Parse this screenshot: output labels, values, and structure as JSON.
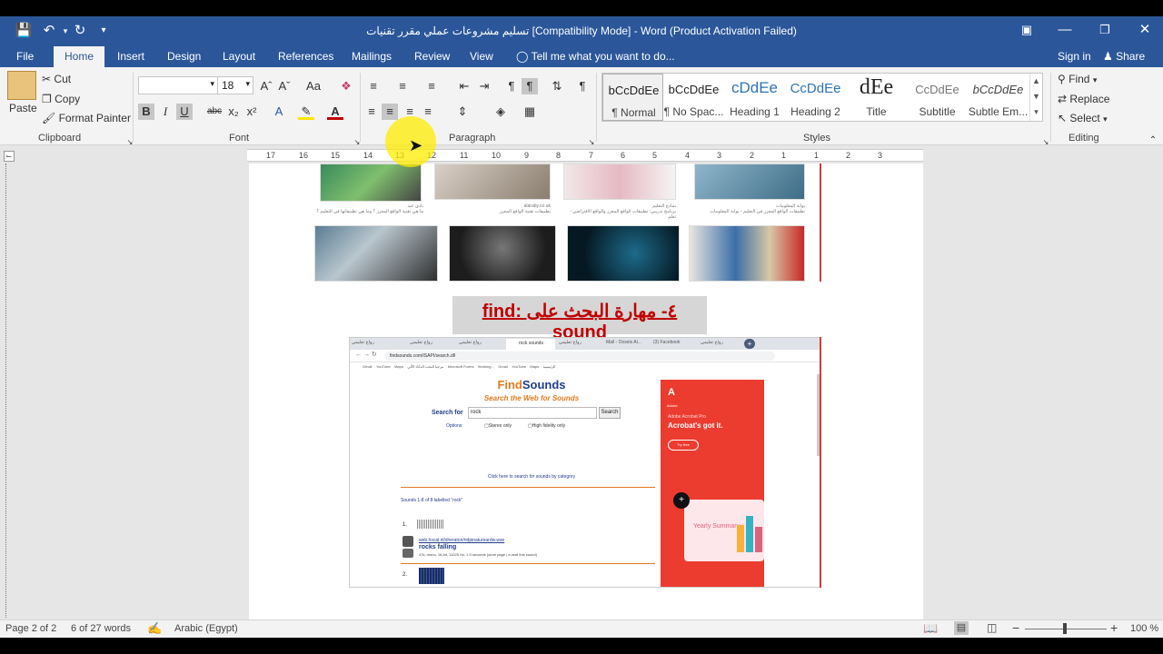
{
  "window": {
    "title": "تسليم مشروعات عملي مقرر تقنيات [Compatibility Mode] - Word (Product Activation Failed)"
  },
  "tabs": [
    "File",
    "Home",
    "Insert",
    "Design",
    "Layout",
    "References",
    "Mailings",
    "Review",
    "View"
  ],
  "tell_me": "Tell me what you want to do...",
  "account": {
    "sign_in": "Sign in",
    "share": "Share"
  },
  "clipboard": {
    "paste": "Paste",
    "cut": "Cut",
    "copy": "Copy",
    "format_painter": "Format Painter",
    "group": "Clipboard"
  },
  "font": {
    "name": "",
    "size": "18",
    "group": "Font",
    "change_case": "Aa"
  },
  "paragraph": {
    "group": "Paragraph"
  },
  "styles": {
    "group": "Styles",
    "items": [
      {
        "preview": "bCcDdEe",
        "label": "¶ Normal"
      },
      {
        "preview": "bCcDdEe",
        "label": "¶ No Spac..."
      },
      {
        "preview": "cDdEe",
        "label": "Heading 1"
      },
      {
        "preview": "CcDdEe",
        "label": "Heading 2"
      },
      {
        "preview": "dEe",
        "label": "Title"
      },
      {
        "preview": "CcDdEe",
        "label": "Subtitle"
      },
      {
        "preview": "bCcDdEe",
        "label": "Subtle Em..."
      }
    ]
  },
  "editing": {
    "find": "Find",
    "replace": "Replace",
    "select": "Select",
    "group": "Editing"
  },
  "ruler": {
    "marks": [
      "17",
      "16",
      "15",
      "14",
      "13",
      "12",
      "11",
      "10",
      "9",
      "8",
      "7",
      "6",
      "5",
      "4",
      "3",
      "2",
      "1",
      "1",
      "2",
      "3"
    ]
  },
  "document": {
    "heading": "٤- مهارة البحث على :find sound",
    "browser": {
      "tabs": [
        "رواج تعليمي",
        "رواج تعليمي",
        "رواج تعليمي",
        "rock sounds",
        "رواج تعليمي",
        "Mail - Ooseis Al...",
        "(3) Facebook",
        "رواج تعليمي"
      ],
      "url": "findsounds.com/ISAPI/search.dll",
      "bookmarks": [
        "Gmail",
        "YouTube",
        "Maps",
        "مرحبا البحث الذكاء الآلي",
        "Microsoft Forms",
        "Working...",
        "Gmail",
        "YouTube",
        "Maps",
        "الرئيسية"
      ],
      "site_name_1": "Find",
      "site_name_2": "Sounds",
      "tagline": "Search the Web for Sounds",
      "search_label": "Search for",
      "search_value": "rock",
      "search_button": "Search",
      "options_label": "Options:",
      "opt1": "Stereo only",
      "opt2": "High fidelity only",
      "category_link": "Click here to search for sounds by category",
      "results_header": "Sounds 1-8 of 8 labelled \"rock\"",
      "result1_num": "1.",
      "result1_url": "web.hscal.nl/sheraton/ndpinatureardw.wav",
      "result1_title": "rocks falling",
      "result1_meta": "47k, mono, 16-bit, 11025 Hz, 1.9 seconds (done page | e-mail this sound)",
      "result2_num": "2.",
      "ad_brand": "Adobe",
      "ad_small": "Adobe Acrobat Pro",
      "ad_headline": "Acrobat's got it.",
      "ad_cta": "Try free",
      "ad_card_title": "Yearly Summary"
    },
    "captions_top": [
      {
        "source": "نادي عبد",
        "text": "ما هي تقنية الواقع المعزز ؟ وما هي تطبيقاتها في التعليم ؟"
      },
      {
        "source": "alaraby.co.uk",
        "text": "تطبيقات تقنية الواقع المعزز"
      },
      {
        "source": "نماذج التعليم",
        "text": "برنامج تدريبي: تطبيقات الواقع المعزز والواقع الافتراضي - تعلم"
      },
      {
        "source": "بوابة المعلومات",
        "text": "تطبيقات الواقع المعزز في التعليم - بوابة المعلومات"
      }
    ]
  },
  "status": {
    "page": "Page 2 of 2",
    "words": "6 of 27 words",
    "language": "Arabic (Egypt)",
    "zoom": "100 %"
  },
  "colors": {
    "accent": "#2b579a",
    "heading_red": "#c00000",
    "ad_red": "#ec3b2f"
  }
}
